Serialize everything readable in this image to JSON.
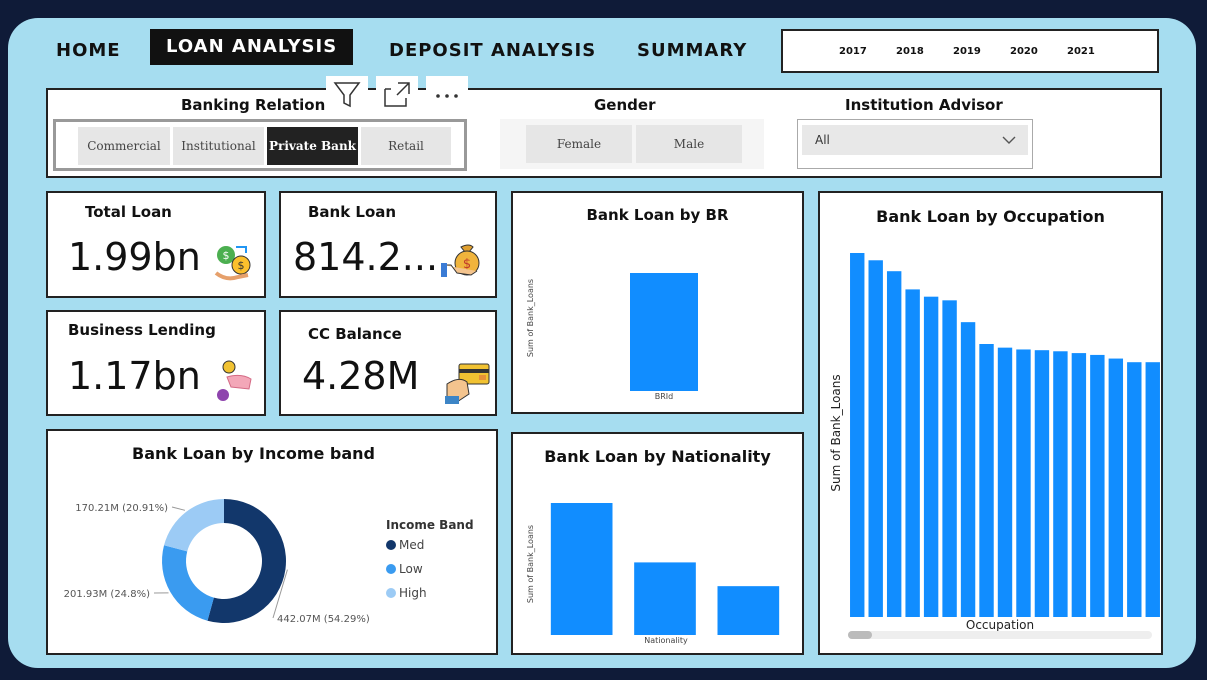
{
  "nav": {
    "home": "HOME",
    "loan_analysis": "LOAN ANALYSIS",
    "deposit_analysis": "DEPOSIT ANALYSIS",
    "summary": "SUMMARY"
  },
  "years": [
    "2017",
    "2018",
    "2019",
    "2020",
    "2021"
  ],
  "filters": {
    "banking_relations": {
      "title": "Banking Relations",
      "options": [
        "Commercial",
        "Institutional",
        "Private Bank",
        "Retail"
      ],
      "selected": "Private Bank"
    },
    "gender": {
      "title": "Gender",
      "options": [
        "Female",
        "Male"
      ]
    },
    "institution_advisor": {
      "title": "Institution Advisor",
      "value": "All"
    }
  },
  "kpis": {
    "total_loan": {
      "label": "Total Loan",
      "value": "1.99bn"
    },
    "bank_loan": {
      "label": "Bank Loan",
      "value": "814.2..."
    },
    "business_lending": {
      "label": "Business Lending",
      "value": "1.17bn"
    },
    "cc_balance": {
      "label": "CC Balance",
      "value": "4.28M"
    }
  },
  "charts": {
    "br": {
      "title": "Bank Loan by BR",
      "xlabel": "BRId",
      "ylabel": "Sum of Bank_Loans"
    },
    "nationality": {
      "title": "Bank Loan by Nationality",
      "xlabel": "Nationality",
      "ylabel": "Sum of Bank_Loans"
    },
    "occupation": {
      "title": "Bank Loan by Occupation",
      "xlabel": "Occupation",
      "ylabel": "Sum of Bank_Loans"
    },
    "income": {
      "title": "Bank Loan by Income band",
      "legend_title": "Income Band",
      "labels": [
        "442.07M (54.29%)",
        "201.93M (24.8%)",
        "170.21M (20.91%)"
      ]
    }
  },
  "colors": {
    "bar": "#118dff",
    "med": "#12376b",
    "low": "#3a9bf0",
    "high": "#9ccbf5"
  },
  "chart_data": [
    {
      "type": "bar",
      "title": "Bank Loan by BR",
      "xlabel": "BRId",
      "ylabel": "Sum of Bank_Loans",
      "categories": [
        ""
      ],
      "values": [
        814.2
      ]
    },
    {
      "type": "bar",
      "title": "Bank Loan by Nationality",
      "xlabel": "Nationality",
      "ylabel": "Sum of Bank_Loans",
      "categories": [
        "",
        "",
        ""
      ],
      "values": [
        100,
        55,
        37
      ]
    },
    {
      "type": "bar",
      "title": "Bank Loan by Occupation",
      "xlabel": "Occupation",
      "ylabel": "Sum of Bank_Loans",
      "categories": [
        "",
        "",
        "",
        "",
        "",
        "",
        "",
        "",
        "",
        "",
        "",
        "",
        "",
        "",
        "",
        "",
        ""
      ],
      "values": [
        100,
        98,
        95,
        90,
        88,
        87,
        81,
        75,
        74,
        73.5,
        73.3,
        73,
        72.5,
        72,
        71,
        70,
        70
      ]
    },
    {
      "type": "pie",
      "title": "Bank Loan by Income band",
      "legend_title": "Income Band",
      "categories": [
        "Med",
        "Low",
        "High"
      ],
      "values": [
        442.07,
        201.93,
        170.21
      ],
      "percent": [
        54.29,
        24.8,
        20.91
      ],
      "legend": "right"
    }
  ]
}
